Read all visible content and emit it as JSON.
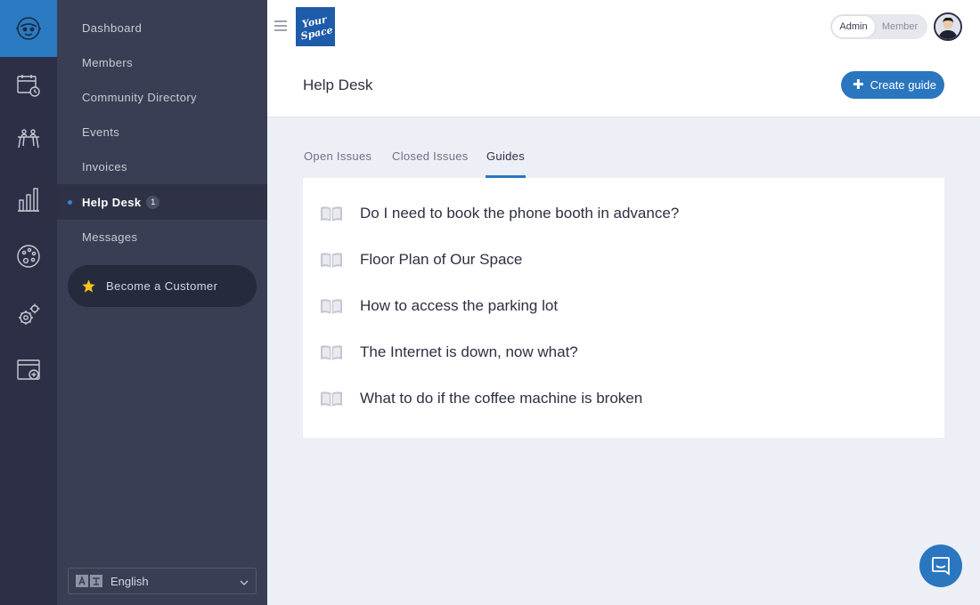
{
  "rail": {
    "icons": [
      "robot-logo-icon",
      "calendar-icon",
      "desk-icon",
      "analytics-icon",
      "palette-icon",
      "settings-icon",
      "browser-window-icon"
    ]
  },
  "sidebar": {
    "items": [
      {
        "label": "Dashboard"
      },
      {
        "label": "Members"
      },
      {
        "label": "Community Directory"
      },
      {
        "label": "Events"
      },
      {
        "label": "Invoices"
      },
      {
        "label": "Help Desk",
        "badge": "1"
      },
      {
        "label": "Messages"
      }
    ],
    "become_customer": "Become a Customer",
    "language": "English"
  },
  "header": {
    "brand": "Your Space",
    "role_options": [
      "Admin",
      "Member"
    ],
    "active_role": "Admin",
    "page_title": "Help Desk",
    "create_button": "Create guide"
  },
  "tabs": [
    {
      "label": "Open Issues"
    },
    {
      "label": "Closed Issues"
    },
    {
      "label": "Guides",
      "active": true
    }
  ],
  "guides": [
    {
      "title": "Do I need to book the phone booth in advance?"
    },
    {
      "title": "Floor Plan of Our Space"
    },
    {
      "title": "How to access the parking lot"
    },
    {
      "title": "The Internet is down, now what?"
    },
    {
      "title": "What to do if the coffee machine is broken"
    }
  ],
  "colors": {
    "accent": "#2a76bf",
    "rail_bg": "#2c2f45",
    "sidebar_bg": "#3a3e54",
    "content_bg": "#eceff6"
  }
}
